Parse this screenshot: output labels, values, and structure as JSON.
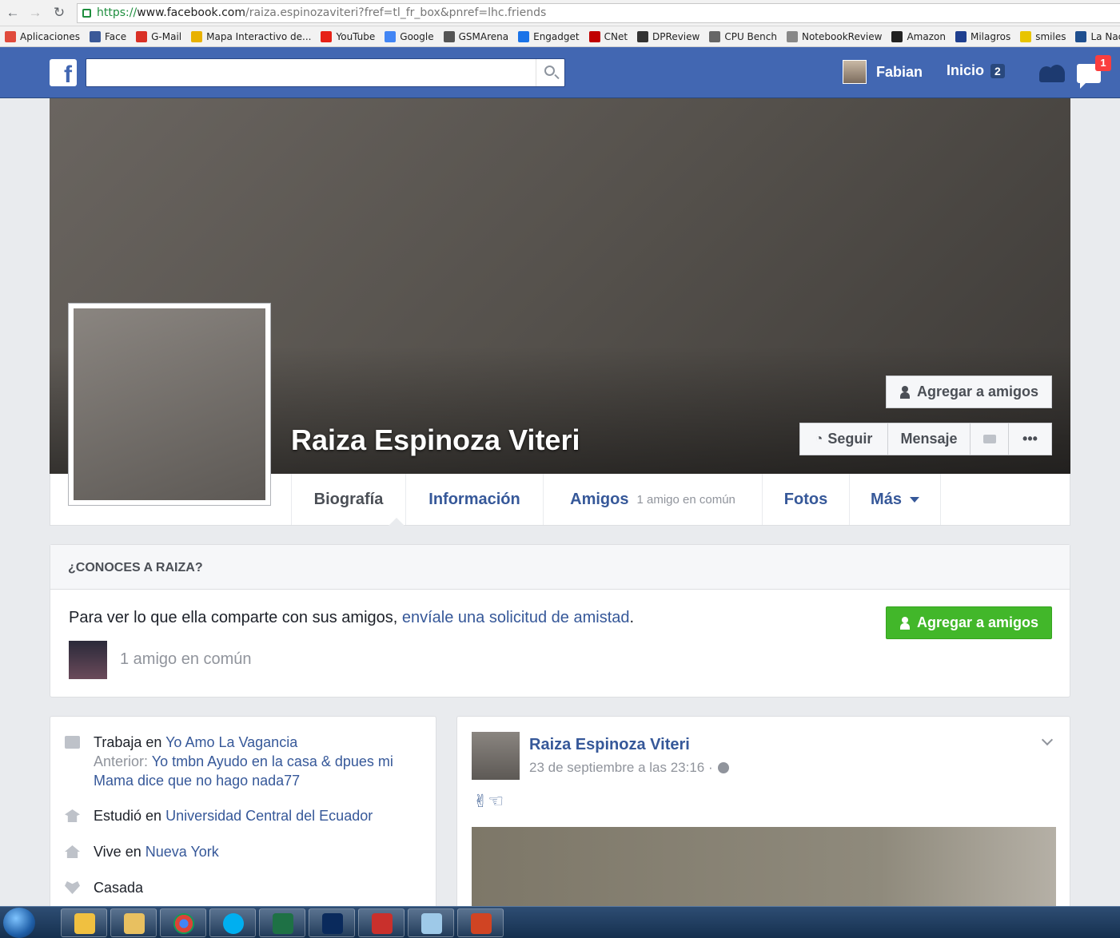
{
  "browser": {
    "url": {
      "scheme": "https://",
      "host": "www.facebook.com",
      "path": "/raiza.espinozaviteri?fref=tl_fr_box&pnref=lhc.friends"
    },
    "bookmarks": [
      {
        "label": "Aplicaciones",
        "icon": "apps-grid-icon",
        "color": "#e04a3c"
      },
      {
        "label": "Face",
        "icon": "facebook-icon",
        "color": "#3b5998"
      },
      {
        "label": "G-Mail",
        "icon": "gmail-icon",
        "color": "#d93025"
      },
      {
        "label": "Mapa Interactivo de...",
        "icon": "map-pin-icon",
        "color": "#e8b100"
      },
      {
        "label": "YouTube",
        "icon": "youtube-icon",
        "color": "#e62117"
      },
      {
        "label": "Google",
        "icon": "google-icon",
        "color": "#4285f4"
      },
      {
        "label": "GSMArena",
        "icon": "gsmarena-icon",
        "color": "#555555"
      },
      {
        "label": "Engadget",
        "icon": "engadget-icon",
        "color": "#1a73e8"
      },
      {
        "label": "CNet",
        "icon": "cnet-icon",
        "color": "#c00000"
      },
      {
        "label": "DPReview",
        "icon": "dpreview-icon",
        "color": "#333333"
      },
      {
        "label": "CPU Bench",
        "icon": "cpubench-icon",
        "color": "#666666"
      },
      {
        "label": "NotebookReview",
        "icon": "notebookreview-icon",
        "color": "#888888"
      },
      {
        "label": "Amazon",
        "icon": "amazon-icon",
        "color": "#222222"
      },
      {
        "label": "Milagros",
        "icon": "milagros-icon",
        "color": "#1f3f8f"
      },
      {
        "label": "smiles",
        "icon": "smiley-icon",
        "color": "#e8c400"
      },
      {
        "label": "La Nación",
        "icon": "lanacion-icon",
        "color": "#1f4f8f"
      }
    ]
  },
  "topbar": {
    "user_name": "Fabian",
    "home_label": "Inicio",
    "home_count": "2",
    "notification_count": "1",
    "colors": {
      "brand": "#4267b2"
    }
  },
  "profile": {
    "name": "Raiza Espinoza Viteri",
    "add_friend_label": "Agregar a amigos",
    "follow_label": "Seguir",
    "message_label": "Mensaje",
    "more_dots": "•••"
  },
  "tabs": [
    {
      "label": "Biografía"
    },
    {
      "label": "Información"
    },
    {
      "label": "Amigos",
      "sub": "1 amigo en común"
    },
    {
      "label": "Fotos"
    },
    {
      "label": "Más"
    }
  ],
  "know_box": {
    "header": "¿CONOCES A RAIZA?",
    "text_before": "Para ver lo que ella comparte con sus amigos, ",
    "link": "envíale una solicitud de amistad",
    "text_after": ".",
    "button": "Agregar a amigos",
    "mutual": "1 amigo en común",
    "colors": {
      "button": "#42b72a"
    }
  },
  "intro": {
    "work_prefix": "Trabaja en",
    "work_place": "Yo Amo La Vagancia",
    "prev_prefix": "Anterior:",
    "prev_place": "Yo tmbn Ayudo en la casa & dpues mi Mama dice que no hago nada77",
    "study_prefix": "Estudió en",
    "study_place": "Universidad Central del Ecuador",
    "live_prefix": "Vive en",
    "live_place": "Nueva York",
    "relationship": "Casada"
  },
  "post": {
    "author": "Raiza Espinoza Viteri",
    "date": "23 de septiembre a las 23:16 ·",
    "text": "✌☜"
  }
}
